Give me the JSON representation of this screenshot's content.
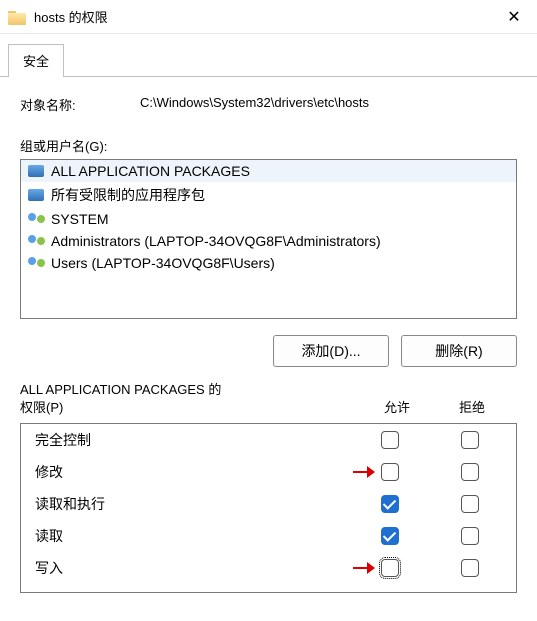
{
  "window": {
    "title": "hosts 的权限",
    "close_glyph": "✕"
  },
  "tab_security": "安全",
  "object_label": "对象名称:",
  "object_value": "C:\\Windows\\System32\\drivers\\etc\\hosts",
  "groups_label": "组或用户名(G):",
  "principals": [
    {
      "icon": "group",
      "name": "ALL APPLICATION PACKAGES",
      "selected": true
    },
    {
      "icon": "group",
      "name": "所有受限制的应用程序包",
      "selected": false
    },
    {
      "icon": "users",
      "name": "SYSTEM",
      "selected": false
    },
    {
      "icon": "users",
      "name": "Administrators (LAPTOP-34OVQG8F\\Administrators)",
      "selected": false
    },
    {
      "icon": "users",
      "name": "Users (LAPTOP-34OVQG8F\\Users)",
      "selected": false
    }
  ],
  "buttons": {
    "add": "添加(D)...",
    "remove": "删除(R)"
  },
  "perm_title_line1": "ALL APPLICATION PACKAGES 的",
  "perm_title_line2": "权限(P)",
  "col_allow": "允许",
  "col_deny": "拒绝",
  "permissions": [
    {
      "name": "完全控制",
      "allow": false,
      "deny": false,
      "arrow": false,
      "focus": false
    },
    {
      "name": "修改",
      "allow": false,
      "deny": false,
      "arrow": true,
      "focus": false
    },
    {
      "name": "读取和执行",
      "allow": true,
      "deny": false,
      "arrow": false,
      "focus": false
    },
    {
      "name": "读取",
      "allow": true,
      "deny": false,
      "arrow": false,
      "focus": false
    },
    {
      "name": "写入",
      "allow": false,
      "deny": false,
      "arrow": true,
      "focus": true
    }
  ]
}
